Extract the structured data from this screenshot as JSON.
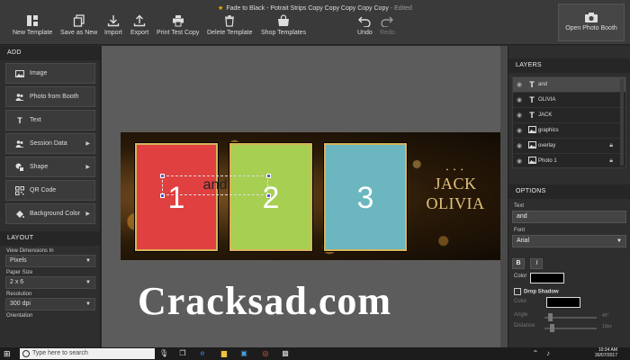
{
  "window": {
    "title": "Fade to Black - Potrait Strips Copy Copy Copy Copy Copy",
    "edited": "- Edited"
  },
  "toolbar": {
    "new_template": "New Template",
    "save_as_new": "Save as New",
    "import": "Import",
    "export": "Export",
    "print_test_copy": "Print Test Copy",
    "delete_template": "Delete Template",
    "shop_templates": "Shop Templates",
    "undo": "Undo",
    "redo": "Redo",
    "open_photo_booth": "Open Photo Booth"
  },
  "add_panel": {
    "heading": "ADD",
    "items": [
      {
        "label": "Image"
      },
      {
        "label": "Photo from Booth"
      },
      {
        "label": "Text"
      },
      {
        "label": "Session Data"
      },
      {
        "label": "Shape"
      },
      {
        "label": "QR Code"
      },
      {
        "label": "Background Color"
      }
    ]
  },
  "layout_panel": {
    "heading": "LAYOUT",
    "view_dimensions_label": "View Dimensions In",
    "view_dimensions_value": "Pixels",
    "paper_size_label": "Paper Size",
    "paper_size_value": "2 x 6",
    "resolution_label": "Resolution",
    "resolution_value": "300 dpi",
    "orientation_label": "Orientation"
  },
  "canvas": {
    "photo_numbers": [
      "1",
      "2",
      "3"
    ],
    "text_box": "and",
    "names_line1": "JACK",
    "names_line2": "OLIVIA",
    "names_dots": "• • •"
  },
  "watermark": "Cracksad.com",
  "layers_panel": {
    "heading": "LAYERS",
    "rows": [
      {
        "name": "and",
        "kind": "T",
        "locked": false,
        "selected": true
      },
      {
        "name": "OLIVIA",
        "kind": "T",
        "locked": false,
        "selected": false
      },
      {
        "name": "JACK",
        "kind": "T",
        "locked": false,
        "selected": false
      },
      {
        "name": "graphics",
        "kind": "img",
        "locked": false,
        "selected": false
      },
      {
        "name": "overlay",
        "kind": "img",
        "locked": true,
        "selected": false
      },
      {
        "name": "Photo 1",
        "kind": "img",
        "locked": true,
        "selected": false
      }
    ]
  },
  "options_panel": {
    "heading": "OPTIONS",
    "text_label": "Text",
    "text_value": "and",
    "font_label": "Font",
    "font_value": "Arial",
    "bold": "B",
    "italic": "I",
    "color_label": "Color",
    "text_color": "#000000",
    "drop_shadow_label": "Drop Shadow",
    "shadow_color_label": "Color",
    "angle_label": "Angle",
    "angle_value": "45°",
    "distance_label": "Distance",
    "distance_value": "10px"
  },
  "taskbar": {
    "search_placeholder": "Type here to search",
    "time": "10:34 AM",
    "date": "30/07/2017"
  }
}
